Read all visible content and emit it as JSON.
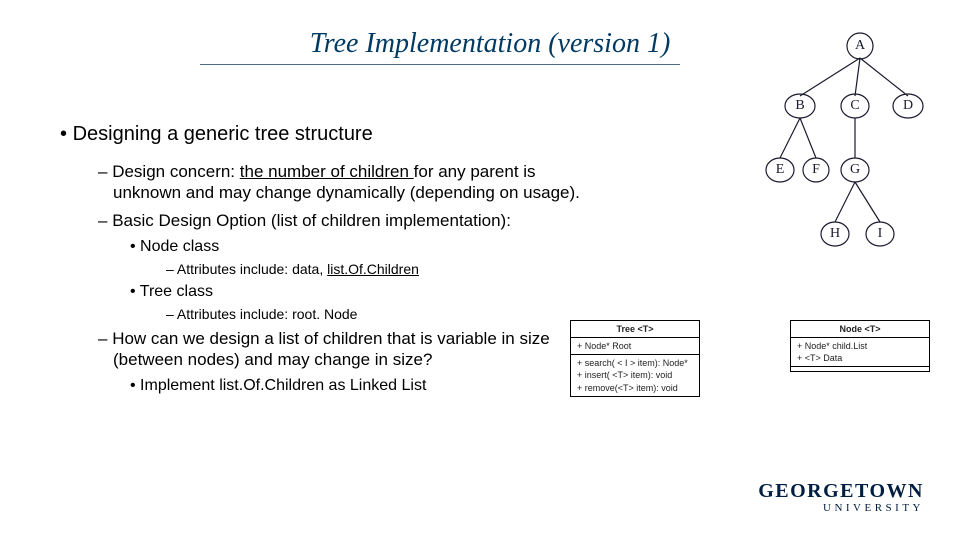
{
  "title": "Tree Implementation (version 1)",
  "content": {
    "b1": "Designing a generic tree structure",
    "b2a_pre": "Design concern: ",
    "b2a_u": "the number of children ",
    "b2a_post": "for any parent is unknown and may change dynamically (depending on usage).",
    "b2b": "Basic Design Option (list of children implementation):",
    "b3a": "Node class",
    "b4a_pre": "Attributes include: data, ",
    "b4a_u": "list.Of.Children",
    "b3b": "Tree class",
    "b4b": "Attributes include: root. Node",
    "b2c": "How can we design a list of children that is variable in size (between nodes) and may change in size?",
    "b3c": "Implement list.Of.Children as Linked List"
  },
  "tree_nodes": {
    "a": "A",
    "b": "B",
    "c": "C",
    "d": "D",
    "e": "E",
    "f": "F",
    "g": "G",
    "h": "H",
    "i": "I"
  },
  "uml": {
    "tree": {
      "header": "Tree <T>",
      "attrs": "+ Node* Root",
      "ops": "+ search( < I > item): Node*\n+ insert( <T> item): void\n+ remove(<T> item): void"
    },
    "node": {
      "header": "Node <T>",
      "attrs": "+ Node* child.List\n+ <T> Data",
      "ops": " "
    }
  },
  "brand": {
    "line1": "GEORGETOWN",
    "line2": "UNIVERSITY"
  }
}
